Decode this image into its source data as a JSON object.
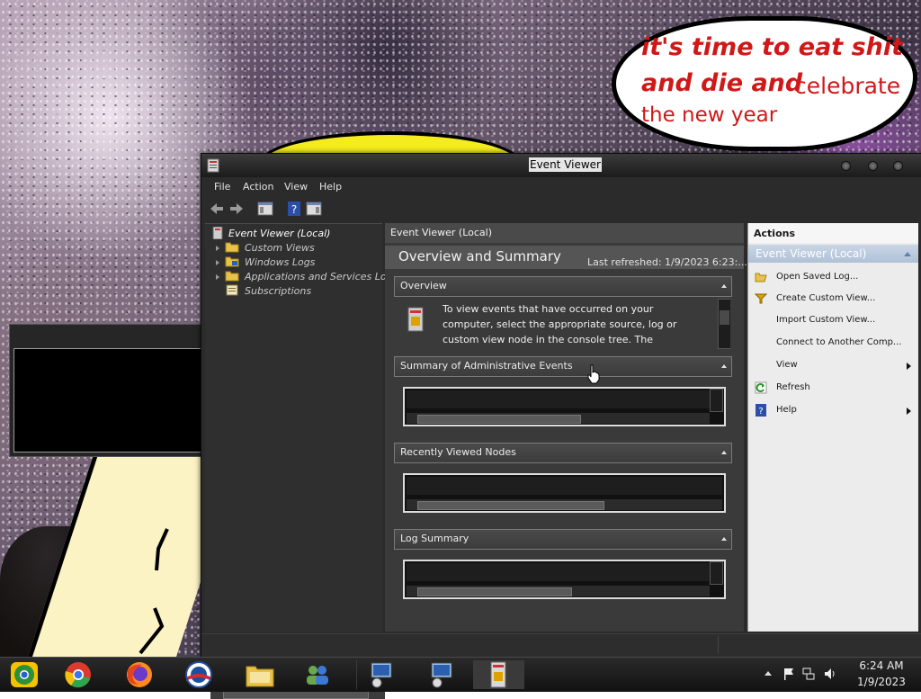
{
  "wallpaper": {
    "bubble_line1": "it's time to eat shit",
    "bubble_line2": "and die and",
    "bubble_line2_tail": "celebrate",
    "bubble_line3": "the new year"
  },
  "window": {
    "title": "Event Viewer",
    "menu": [
      "File",
      "Action",
      "View",
      "Help"
    ],
    "toolbar_icons": [
      "back-arrow-icon",
      "forward-arrow-icon",
      "show-hide-tree-icon",
      "help-icon",
      "show-hide-action-pane-icon"
    ]
  },
  "tree": {
    "root": "Event Viewer (Local)",
    "children": [
      "Custom Views",
      "Windows Logs",
      "Applications and Services Logs",
      "Subscriptions"
    ]
  },
  "center": {
    "header": "Event Viewer (Local)",
    "overview_title": "Overview and Summary",
    "last_refreshed": "Last refreshed: 1/9/2023 6:23:...",
    "sections": {
      "overview": "Overview",
      "admin_events": "Summary of Administrative Events",
      "recent_nodes": "Recently Viewed Nodes",
      "log_summary": "Log Summary"
    },
    "overview_text": "To view events that have occurred on your computer, select the appropriate source, log or custom view node in the console tree. The"
  },
  "actions": {
    "header": "Actions",
    "group": "Event Viewer (Local)",
    "items": [
      {
        "label": "Open Saved Log...",
        "icon": "folder-open-icon"
      },
      {
        "label": "Create Custom View...",
        "icon": "filter-icon"
      },
      {
        "label": "Import Custom View...",
        "icon": ""
      },
      {
        "label": "Connect to Another Comp...",
        "icon": ""
      },
      {
        "label": "View",
        "icon": "",
        "submenu": true
      },
      {
        "label": "Refresh",
        "icon": "refresh-icon"
      },
      {
        "label": "Help",
        "icon": "help-icon",
        "submenu": true
      }
    ]
  },
  "taskbar": {
    "apps": [
      "chrome-alt-icon",
      "chrome-icon",
      "firefox-icon",
      "obama-logo-icon",
      "file-explorer-icon",
      "network-users-icon",
      "remote-desktop-icon",
      "remote-desktop-2-icon",
      "event-viewer-icon"
    ],
    "clock_time": "6:24 AM",
    "clock_date": "1/9/2023"
  },
  "colors": {
    "window_bg": "#2b2b2b",
    "actions_bg": "#ececec",
    "actions_group": "#b7c7da",
    "bubble_text": "#d01818"
  }
}
